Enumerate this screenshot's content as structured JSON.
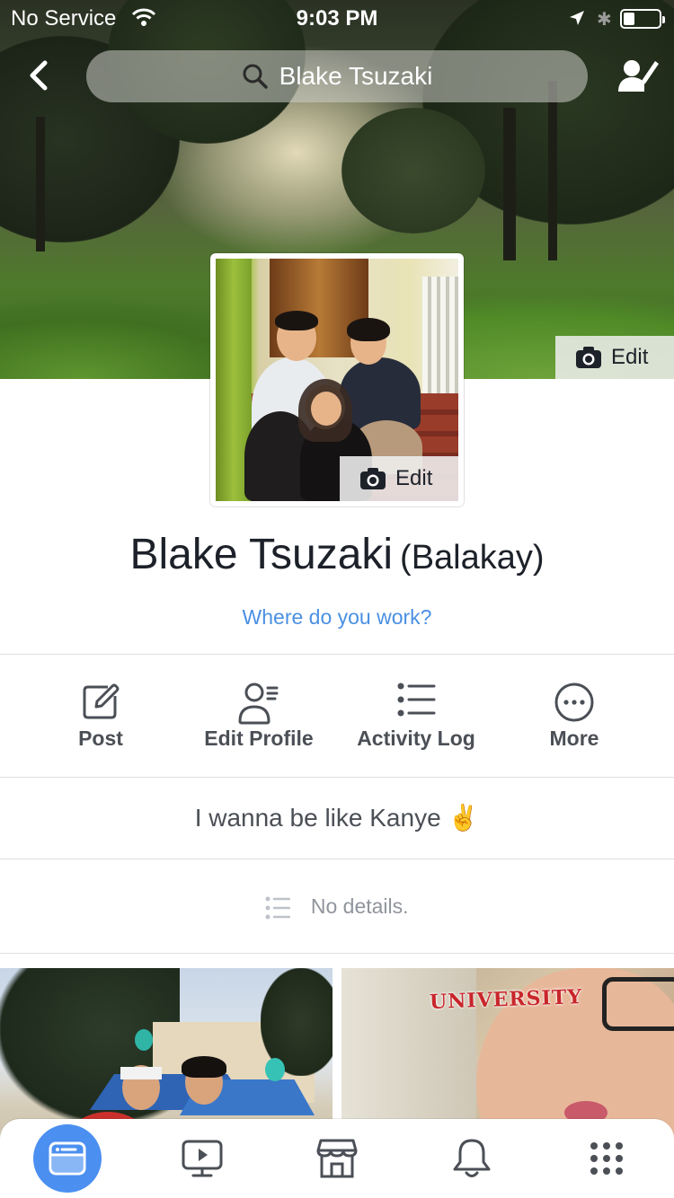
{
  "status_bar": {
    "carrier": "No Service",
    "time": "9:03 PM"
  },
  "nav": {
    "search_text": "Blake Tsuzaki"
  },
  "cover": {
    "edit_label": "Edit"
  },
  "profile_picture": {
    "edit_label": "Edit"
  },
  "profile": {
    "name": "Blake Tsuzaki",
    "nickname": "(Balakay)",
    "work_prompt": "Where do you work?"
  },
  "actions": [
    {
      "label": "Post",
      "icon": "compose-icon"
    },
    {
      "label": "Edit Profile",
      "icon": "edit-profile-icon"
    },
    {
      "label": "Activity Log",
      "icon": "list-icon"
    },
    {
      "label": "More",
      "icon": "more-icon"
    }
  ],
  "bio": {
    "text": "I wanna be like Kanye ✌️"
  },
  "details": {
    "text": "No details."
  },
  "photos": {
    "photo2_caption": "UNIVERSITY"
  },
  "tab_bar": {
    "items": [
      "news-feed-icon",
      "watch-icon",
      "marketplace-icon",
      "notifications-icon",
      "menu-icon"
    ],
    "active": "news-feed-icon"
  },
  "colors": {
    "link_blue": "#4a90e2",
    "active_tab": "#4b8ff0",
    "text_dark": "#1d2129",
    "text_gray": "#4b4f56"
  }
}
